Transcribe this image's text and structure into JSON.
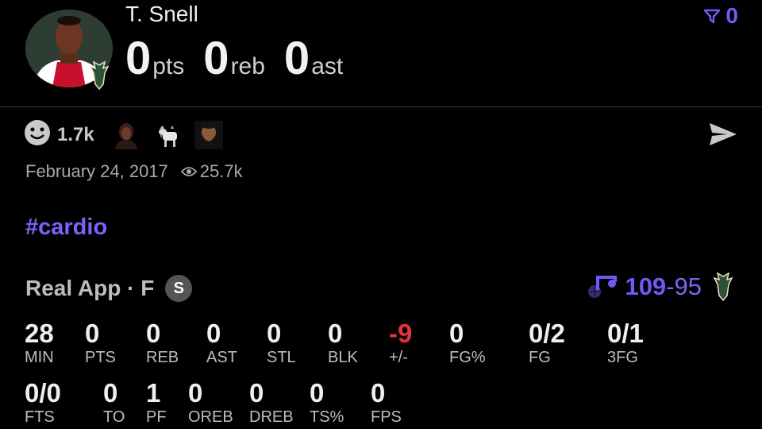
{
  "player": {
    "name": "T. Snell",
    "pts": "0",
    "pts_unit": "pts",
    "reb": "0",
    "reb_unit": "reb",
    "ast": "0",
    "ast_unit": "ast"
  },
  "filter": {
    "count": "0",
    "color": "#6f5af5"
  },
  "reactions": {
    "count": "1.7k",
    "icons": [
      "smiley-icon",
      "person-reaction-icon",
      "goat-icon",
      "bearded-man-icon"
    ]
  },
  "post": {
    "date": "February 24, 2017",
    "views": "25.7k",
    "hashtag": "#cardio"
  },
  "game": {
    "label": "Real App · F",
    "badge": "S",
    "score_home": "109",
    "score_sep": "-",
    "score_away": "95"
  },
  "stats_row1": [
    {
      "value": "28",
      "label": "MIN"
    },
    {
      "value": "0",
      "label": "PTS"
    },
    {
      "value": "0",
      "label": "REB"
    },
    {
      "value": "0",
      "label": "AST"
    },
    {
      "value": "0",
      "label": "STL"
    },
    {
      "value": "0",
      "label": "BLK"
    },
    {
      "value": "-9",
      "label": "+/-"
    },
    {
      "value": "0",
      "label": "FG%"
    },
    {
      "value": "0/2",
      "label": "FG"
    },
    {
      "value": "0/1",
      "label": "3FG"
    }
  ],
  "stats_row2": [
    {
      "value": "0/0",
      "label": "FTS"
    },
    {
      "value": "0",
      "label": "TO"
    },
    {
      "value": "1",
      "label": "PF"
    },
    {
      "value": "0",
      "label": "OREB"
    },
    {
      "value": "0",
      "label": "DREB"
    },
    {
      "value": "0",
      "label": "TS%"
    },
    {
      "value": "0",
      "label": "FPS"
    }
  ],
  "colors": {
    "accent": "#6f5af5",
    "negative": "#e9313d",
    "bucks_green": "#2c5234"
  }
}
